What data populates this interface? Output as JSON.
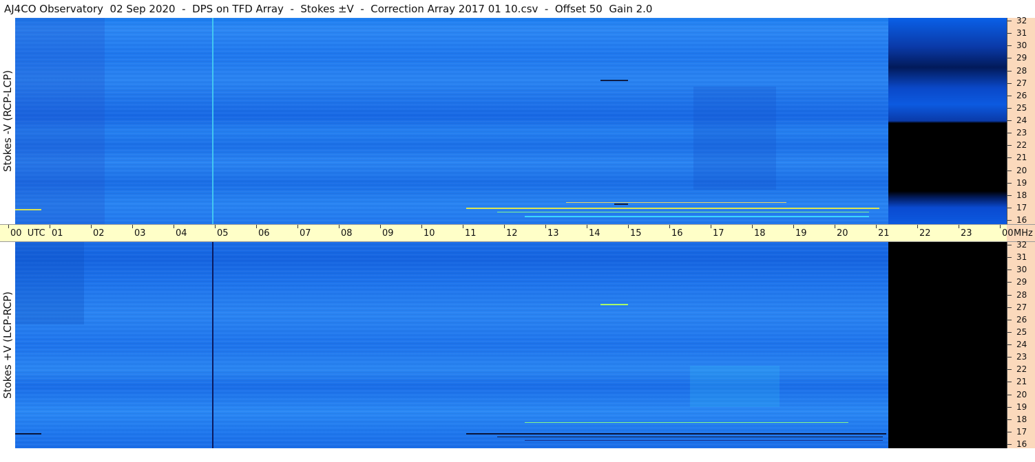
{
  "title": "AJ4CO Observatory  02 Sep 2020  -  DPS on TFD Array  -  Stokes ±V  -  Correction Array 2017 01 10.csv  -  Offset 50  Gain 2.0",
  "top_panel": {
    "label": "Stokes -V (RCP-LCP)"
  },
  "bottom_panel": {
    "label": "Stokes +V (LCP-RCP)"
  },
  "frequency_ticks": [
    "32",
    "31",
    "30",
    "29",
    "28",
    "27",
    "26",
    "25",
    "24",
    "23",
    "22",
    "21",
    "20",
    "19",
    "18",
    "17",
    "16"
  ],
  "time_axis": {
    "ticks": [
      "00  UTC",
      "01",
      "02",
      "03",
      "04",
      "05",
      "06",
      "07",
      "08",
      "09",
      "10",
      "11",
      "12",
      "13",
      "14",
      "15",
      "16",
      "17",
      "18",
      "19",
      "20",
      "21",
      "22",
      "23",
      "00"
    ],
    "unit": "MHz"
  },
  "colors": {
    "spectrogram_base": "#1a6ee8",
    "no_data": "#000000",
    "time_axis_bg": "#ffffc8",
    "freq_axis_bg": "#fbd9bc"
  }
}
